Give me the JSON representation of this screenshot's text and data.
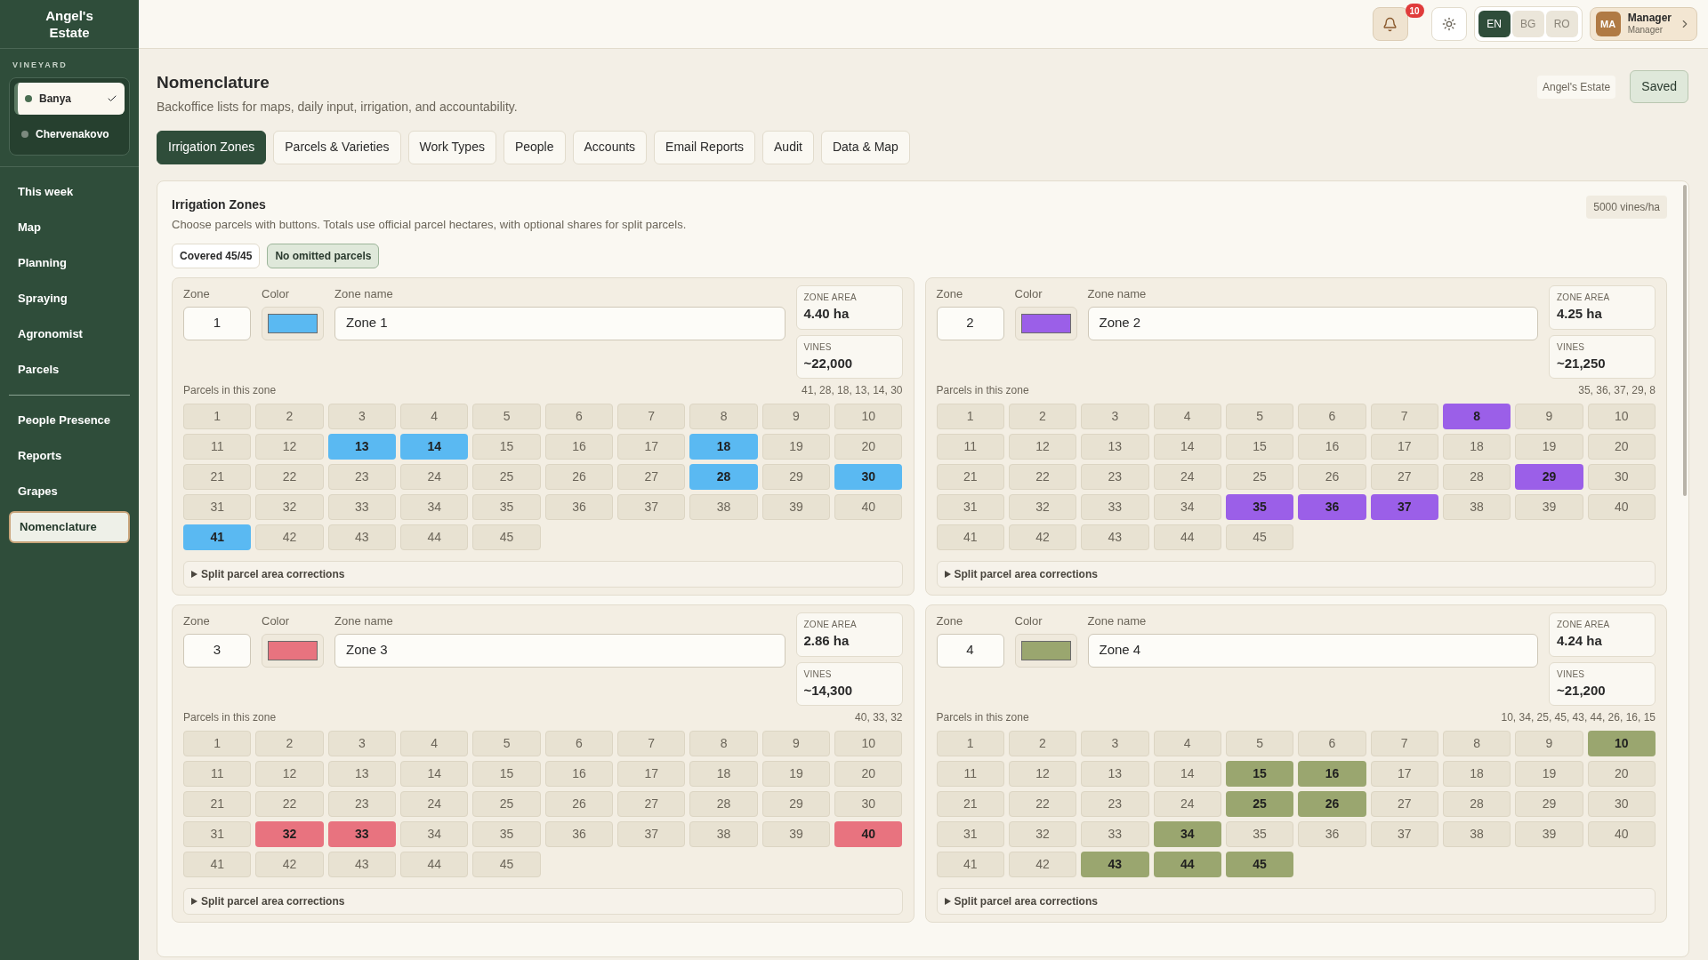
{
  "sidebar": {
    "brand": "Angel's Estate",
    "vineyard_label": "VINEYARD",
    "vineyards": [
      {
        "name": "Banya",
        "selected": true
      },
      {
        "name": "Chervenakovo",
        "selected": false
      }
    ],
    "nav_groups": [
      [
        {
          "label": "This week",
          "selected": false
        },
        {
          "label": "Map",
          "selected": false
        },
        {
          "label": "Planning",
          "selected": false
        },
        {
          "label": "Spraying",
          "selected": false
        },
        {
          "label": "Agronomist",
          "selected": false
        },
        {
          "label": "Parcels",
          "selected": false
        }
      ],
      [
        {
          "label": "People Presence",
          "selected": false
        },
        {
          "label": "Reports",
          "selected": false
        },
        {
          "label": "Grapes",
          "selected": false
        },
        {
          "label": "Nomenclature",
          "selected": true
        }
      ]
    ]
  },
  "topbar": {
    "notifications": "10",
    "languages": [
      {
        "label": "EN",
        "selected": true
      },
      {
        "label": "BG",
        "selected": false
      },
      {
        "label": "RO",
        "selected": false
      }
    ],
    "user": {
      "initials": "MA",
      "name": "Manager",
      "role": "Manager"
    }
  },
  "page": {
    "title": "Nomenclature",
    "subtitle": "Backoffice lists for maps, daily input, irrigation, and accountability.",
    "estate": "Angel's Estate",
    "save_status": "Saved"
  },
  "tabs": [
    {
      "label": "Irrigation Zones",
      "selected": true
    },
    {
      "label": "Parcels & Varieties",
      "selected": false
    },
    {
      "label": "Work Types",
      "selected": false
    },
    {
      "label": "People",
      "selected": false
    },
    {
      "label": "Accounts",
      "selected": false
    },
    {
      "label": "Email Reports",
      "selected": false
    },
    {
      "label": "Audit",
      "selected": false
    },
    {
      "label": "Data & Map",
      "selected": false
    }
  ],
  "panel": {
    "title": "Irrigation Zones",
    "description": "Choose parcels with buttons. Totals use official parcel hectares, with optional shares for split parcels.",
    "density": "5000 vines/ha",
    "badges": [
      {
        "text": "Covered 45/45",
        "kind": "neutral"
      },
      {
        "text": "No omitted parcels",
        "kind": "success"
      }
    ],
    "zones": [
      {
        "zone_label": "Zone",
        "number": "1",
        "color_label": "Color",
        "color": "#5ab9f2",
        "name_label": "Zone name",
        "name": "Zone 1",
        "area_label": "ZONE AREA",
        "area": "4.40 ha",
        "vines_label": "VINES",
        "vines": "~22,000",
        "parcels_label": "Parcels in this zone",
        "parcel_summary": "41, 28, 18, 13, 14, 30",
        "split_label": "Split parcel area corrections",
        "parcels": [
          {
            "label": "1",
            "selected": false
          },
          {
            "label": "2",
            "selected": false
          },
          {
            "label": "3",
            "selected": false
          },
          {
            "label": "4",
            "selected": false
          },
          {
            "label": "5",
            "selected": false
          },
          {
            "label": "6",
            "selected": false
          },
          {
            "label": "7",
            "selected": false
          },
          {
            "label": "8",
            "selected": false
          },
          {
            "label": "9",
            "selected": false
          },
          {
            "label": "10",
            "selected": false
          },
          {
            "label": "11",
            "selected": false
          },
          {
            "label": "12",
            "selected": false
          },
          {
            "label": "13",
            "selected": true
          },
          {
            "label": "14",
            "selected": true
          },
          {
            "label": "15",
            "selected": false
          },
          {
            "label": "16",
            "selected": false
          },
          {
            "label": "17",
            "selected": false
          },
          {
            "label": "18",
            "selected": true
          },
          {
            "label": "19",
            "selected": false
          },
          {
            "label": "20",
            "selected": false
          },
          {
            "label": "21",
            "selected": false
          },
          {
            "label": "22",
            "selected": false
          },
          {
            "label": "23",
            "selected": false
          },
          {
            "label": "24",
            "selected": false
          },
          {
            "label": "25",
            "selected": false
          },
          {
            "label": "26",
            "selected": false
          },
          {
            "label": "27",
            "selected": false
          },
          {
            "label": "28",
            "selected": true
          },
          {
            "label": "29",
            "selected": false
          },
          {
            "label": "30",
            "selected": true
          },
          {
            "label": "31",
            "selected": false
          },
          {
            "label": "32",
            "selected": false
          },
          {
            "label": "33",
            "selected": false
          },
          {
            "label": "34",
            "selected": false
          },
          {
            "label": "35",
            "selected": false
          },
          {
            "label": "36",
            "selected": false
          },
          {
            "label": "37",
            "selected": false
          },
          {
            "label": "38",
            "selected": false
          },
          {
            "label": "39",
            "selected": false
          },
          {
            "label": "40",
            "selected": false
          },
          {
            "label": "41",
            "selected": true
          },
          {
            "label": "42",
            "selected": false
          },
          {
            "label": "43",
            "selected": false
          },
          {
            "label": "44",
            "selected": false
          },
          {
            "label": "45",
            "selected": false
          }
        ]
      },
      {
        "zone_label": "Zone",
        "number": "2",
        "color_label": "Color",
        "color": "#9b5fe8",
        "name_label": "Zone name",
        "name": "Zone 2",
        "area_label": "ZONE AREA",
        "area": "4.25 ha",
        "vines_label": "VINES",
        "vines": "~21,250",
        "parcels_label": "Parcels in this zone",
        "parcel_summary": "35, 36, 37, 29, 8",
        "split_label": "Split parcel area corrections",
        "parcels": [
          {
            "label": "1",
            "selected": false
          },
          {
            "label": "2",
            "selected": false
          },
          {
            "label": "3",
            "selected": false
          },
          {
            "label": "4",
            "selected": false
          },
          {
            "label": "5",
            "selected": false
          },
          {
            "label": "6",
            "selected": false
          },
          {
            "label": "7",
            "selected": false
          },
          {
            "label": "8",
            "selected": true
          },
          {
            "label": "9",
            "selected": false
          },
          {
            "label": "10",
            "selected": false
          },
          {
            "label": "11",
            "selected": false
          },
          {
            "label": "12",
            "selected": false
          },
          {
            "label": "13",
            "selected": false
          },
          {
            "label": "14",
            "selected": false
          },
          {
            "label": "15",
            "selected": false
          },
          {
            "label": "16",
            "selected": false
          },
          {
            "label": "17",
            "selected": false
          },
          {
            "label": "18",
            "selected": false
          },
          {
            "label": "19",
            "selected": false
          },
          {
            "label": "20",
            "selected": false
          },
          {
            "label": "21",
            "selected": false
          },
          {
            "label": "22",
            "selected": false
          },
          {
            "label": "23",
            "selected": false
          },
          {
            "label": "24",
            "selected": false
          },
          {
            "label": "25",
            "selected": false
          },
          {
            "label": "26",
            "selected": false
          },
          {
            "label": "27",
            "selected": false
          },
          {
            "label": "28",
            "selected": false
          },
          {
            "label": "29",
            "selected": true
          },
          {
            "label": "30",
            "selected": false
          },
          {
            "label": "31",
            "selected": false
          },
          {
            "label": "32",
            "selected": false
          },
          {
            "label": "33",
            "selected": false
          },
          {
            "label": "34",
            "selected": false
          },
          {
            "label": "35",
            "selected": true
          },
          {
            "label": "36",
            "selected": true
          },
          {
            "label": "37",
            "selected": true
          },
          {
            "label": "38",
            "selected": false
          },
          {
            "label": "39",
            "selected": false
          },
          {
            "label": "40",
            "selected": false
          },
          {
            "label": "41",
            "selected": false
          },
          {
            "label": "42",
            "selected": false
          },
          {
            "label": "43",
            "selected": false
          },
          {
            "label": "44",
            "selected": false
          },
          {
            "label": "45",
            "selected": false
          }
        ]
      },
      {
        "zone_label": "Zone",
        "number": "3",
        "color_label": "Color",
        "color": "#e8737f",
        "name_label": "Zone name",
        "name": "Zone 3",
        "area_label": "ZONE AREA",
        "area": "2.86 ha",
        "vines_label": "VINES",
        "vines": "~14,300",
        "parcels_label": "Parcels in this zone",
        "parcel_summary": "40, 33, 32",
        "split_label": "Split parcel area corrections",
        "parcels": [
          {
            "label": "1",
            "selected": false
          },
          {
            "label": "2",
            "selected": false
          },
          {
            "label": "3",
            "selected": false
          },
          {
            "label": "4",
            "selected": false
          },
          {
            "label": "5",
            "selected": false
          },
          {
            "label": "6",
            "selected": false
          },
          {
            "label": "7",
            "selected": false
          },
          {
            "label": "8",
            "selected": false
          },
          {
            "label": "9",
            "selected": false
          },
          {
            "label": "10",
            "selected": false
          },
          {
            "label": "11",
            "selected": false
          },
          {
            "label": "12",
            "selected": false
          },
          {
            "label": "13",
            "selected": false
          },
          {
            "label": "14",
            "selected": false
          },
          {
            "label": "15",
            "selected": false
          },
          {
            "label": "16",
            "selected": false
          },
          {
            "label": "17",
            "selected": false
          },
          {
            "label": "18",
            "selected": false
          },
          {
            "label": "19",
            "selected": false
          },
          {
            "label": "20",
            "selected": false
          },
          {
            "label": "21",
            "selected": false
          },
          {
            "label": "22",
            "selected": false
          },
          {
            "label": "23",
            "selected": false
          },
          {
            "label": "24",
            "selected": false
          },
          {
            "label": "25",
            "selected": false
          },
          {
            "label": "26",
            "selected": false
          },
          {
            "label": "27",
            "selected": false
          },
          {
            "label": "28",
            "selected": false
          },
          {
            "label": "29",
            "selected": false
          },
          {
            "label": "30",
            "selected": false
          },
          {
            "label": "31",
            "selected": false
          },
          {
            "label": "32",
            "selected": true
          },
          {
            "label": "33",
            "selected": true
          },
          {
            "label": "34",
            "selected": false
          },
          {
            "label": "35",
            "selected": false
          },
          {
            "label": "36",
            "selected": false
          },
          {
            "label": "37",
            "selected": false
          },
          {
            "label": "38",
            "selected": false
          },
          {
            "label": "39",
            "selected": false
          },
          {
            "label": "40",
            "selected": true
          },
          {
            "label": "41",
            "selected": false
          },
          {
            "label": "42",
            "selected": false
          },
          {
            "label": "43",
            "selected": false
          },
          {
            "label": "44",
            "selected": false
          },
          {
            "label": "45",
            "selected": false
          }
        ]
      },
      {
        "zone_label": "Zone",
        "number": "4",
        "color_label": "Color",
        "color": "#9aa66f",
        "name_label": "Zone name",
        "name": "Zone 4",
        "area_label": "ZONE AREA",
        "area": "4.24 ha",
        "vines_label": "VINES",
        "vines": "~21,200",
        "parcels_label": "Parcels in this zone",
        "parcel_summary": "10, 34, 25, 45, 43, 44, 26, 16, 15",
        "split_label": "Split parcel area corrections",
        "parcels": [
          {
            "label": "1",
            "selected": false
          },
          {
            "label": "2",
            "selected": false
          },
          {
            "label": "3",
            "selected": false
          },
          {
            "label": "4",
            "selected": false
          },
          {
            "label": "5",
            "selected": false
          },
          {
            "label": "6",
            "selected": false
          },
          {
            "label": "7",
            "selected": false
          },
          {
            "label": "8",
            "selected": false
          },
          {
            "label": "9",
            "selected": false
          },
          {
            "label": "10",
            "selected": true
          },
          {
            "label": "11",
            "selected": false
          },
          {
            "label": "12",
            "selected": false
          },
          {
            "label": "13",
            "selected": false
          },
          {
            "label": "14",
            "selected": false
          },
          {
            "label": "15",
            "selected": true
          },
          {
            "label": "16",
            "selected": true
          },
          {
            "label": "17",
            "selected": false
          },
          {
            "label": "18",
            "selected": false
          },
          {
            "label": "19",
            "selected": false
          },
          {
            "label": "20",
            "selected": false
          },
          {
            "label": "21",
            "selected": false
          },
          {
            "label": "22",
            "selected": false
          },
          {
            "label": "23",
            "selected": false
          },
          {
            "label": "24",
            "selected": false
          },
          {
            "label": "25",
            "selected": true
          },
          {
            "label": "26",
            "selected": true
          },
          {
            "label": "27",
            "selected": false
          },
          {
            "label": "28",
            "selected": false
          },
          {
            "label": "29",
            "selected": false
          },
          {
            "label": "30",
            "selected": false
          },
          {
            "label": "31",
            "selected": false
          },
          {
            "label": "32",
            "selected": false
          },
          {
            "label": "33",
            "selected": false
          },
          {
            "label": "34",
            "selected": true
          },
          {
            "label": "35",
            "selected": false
          },
          {
            "label": "36",
            "selected": false
          },
          {
            "label": "37",
            "selected": false
          },
          {
            "label": "38",
            "selected": false
          },
          {
            "label": "39",
            "selected": false
          },
          {
            "label": "40",
            "selected": false
          },
          {
            "label": "41",
            "selected": false
          },
          {
            "label": "42",
            "selected": false
          },
          {
            "label": "43",
            "selected": true
          },
          {
            "label": "44",
            "selected": true
          },
          {
            "label": "45",
            "selected": true
          }
        ]
      }
    ]
  }
}
